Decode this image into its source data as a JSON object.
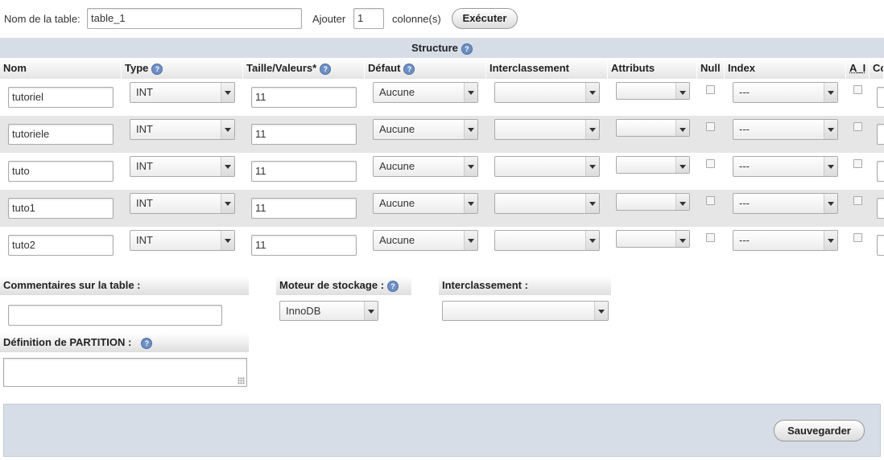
{
  "top": {
    "table_name_label": "Nom de la table:",
    "table_name_value": "table_1",
    "add_label": "Ajouter",
    "add_count": "1",
    "columns_label": "colonne(s)",
    "execute_label": "Exécuter"
  },
  "structure": {
    "title": "Structure",
    "headers": {
      "nom": "Nom",
      "type": "Type",
      "taille": "Taille/Valeurs*",
      "defaut": "Défaut",
      "interclassement": "Interclassement",
      "attributs": "Attributs",
      "null": "Null",
      "index": "Index",
      "ai": "A_I",
      "co": "Co"
    },
    "rows": [
      {
        "name": "tutoriel",
        "type": "INT",
        "size": "11",
        "default": "Aucune",
        "collation": "",
        "attributes": "",
        "index": "---"
      },
      {
        "name": "tutoriele",
        "type": "INT",
        "size": "11",
        "default": "Aucune",
        "collation": "",
        "attributes": "",
        "index": "---"
      },
      {
        "name": "tuto",
        "type": "INT",
        "size": "11",
        "default": "Aucune",
        "collation": "",
        "attributes": "",
        "index": "---"
      },
      {
        "name": "tuto1",
        "type": "INT",
        "size": "11",
        "default": "Aucune",
        "collation": "",
        "attributes": "",
        "index": "---"
      },
      {
        "name": "tuto2",
        "type": "INT",
        "size": "11",
        "default": "Aucune",
        "collation": "",
        "attributes": "",
        "index": "---"
      }
    ]
  },
  "options": {
    "comments_label": "Commentaires sur la table :",
    "comments_value": "",
    "engine_label": "Moteur de stockage :",
    "engine_value": "InnoDB",
    "collation_label": "Interclassement :",
    "collation_value": "",
    "partition_label": "Définition de PARTITION :"
  },
  "footer": {
    "save_label": "Sauvegarder"
  },
  "icons": {
    "help": "help-icon"
  },
  "colors": {
    "header_band": "#d6dde6",
    "alt_row": "#e6e6e6",
    "help_icon": "#6d8fc4"
  }
}
